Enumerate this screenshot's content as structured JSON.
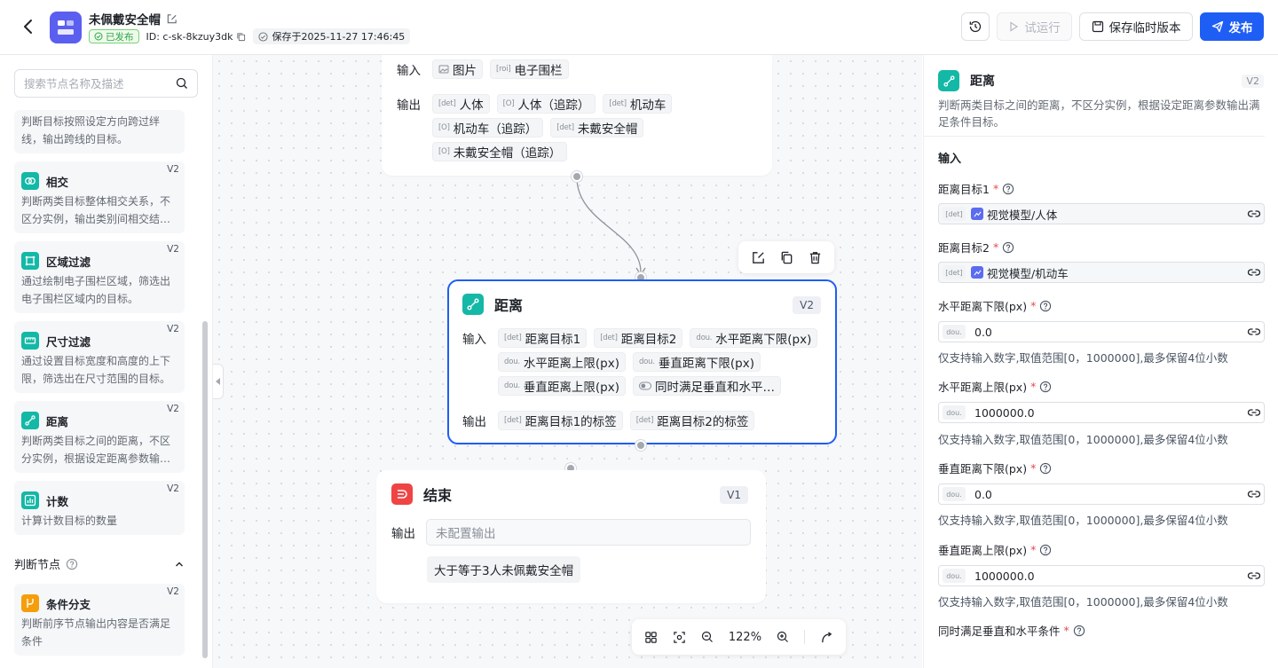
{
  "header": {
    "app_title": "未佩戴安全帽",
    "status": "已发布",
    "id_text": "ID: c-sk-8kzuy3dk",
    "saved_text": "保存于2025-11-27 17:46:45",
    "run_label": "试运行",
    "save_version_label": "保存临时版本",
    "publish_label": "发布"
  },
  "left": {
    "search_placeholder": "搜索节点名称及描述",
    "cards": [
      {
        "desc": "判断目标按照设定方向跨过绊线，输出跨线的目标。"
      },
      {
        "title": "相交",
        "version": "V2",
        "desc": "判断两类目标整体相交关系，不区分实例，输出类别间相交结…"
      },
      {
        "title": "区域过滤",
        "version": "V2",
        "desc": "通过绘制电子围栏区域，筛选出电子围栏区域内的目标。"
      },
      {
        "title": "尺寸过滤",
        "version": "V2",
        "desc": "通过设置目标宽度和高度的上下限，筛选出在尺寸范围的目标。"
      },
      {
        "title": "距离",
        "version": "V2",
        "desc": "判断两类目标之间的距离，不区分实例，根据设定距离参数输…"
      },
      {
        "title": "计数",
        "version": "V2",
        "desc": "计算计数目标的数量"
      },
      {
        "title": "条件分支",
        "version": "V2",
        "desc": "判断前序节点输出内容是否满足条件"
      }
    ],
    "section_title": "判断节点"
  },
  "canvas": {
    "top_node": {
      "input_label": "输入",
      "inputs": [
        {
          "tag": "",
          "text": "图片"
        },
        {
          "tag": "[roi]",
          "text": "电子围栏"
        }
      ],
      "output_label": "输出",
      "outputs_row1": [
        {
          "tag": "[det]",
          "text": "人体"
        },
        {
          "tag": "[O]",
          "text": "人体（追踪）"
        },
        {
          "tag": "[det]",
          "text": "机动车"
        }
      ],
      "outputs_row2": [
        {
          "tag": "[O]",
          "text": "机动车（追踪）"
        },
        {
          "tag": "[det]",
          "text": "未戴安全帽"
        }
      ],
      "outputs_row3": [
        {
          "tag": "[O]",
          "text": "未戴安全帽（追踪）"
        }
      ]
    },
    "distance_node": {
      "title": "距离",
      "version": "V2",
      "input_label": "输入",
      "inputs_row1": [
        {
          "tag": "[det]",
          "text": "距离目标1"
        },
        {
          "tag": "[det]",
          "text": "距离目标2"
        },
        {
          "tag": "dou.",
          "text": "水平距离下限(px)"
        }
      ],
      "inputs_row2": [
        {
          "tag": "dou.",
          "text": "水平距离上限(px)"
        },
        {
          "tag": "dou.",
          "text": "垂直距离下限(px)"
        }
      ],
      "inputs_row3": [
        {
          "tag": "dou.",
          "text": "垂直距离上限(px)"
        },
        {
          "tag": "",
          "text": "同时满足垂直和水平…"
        }
      ],
      "output_label": "输出",
      "outputs": [
        {
          "tag": "[det]",
          "text": "距离目标1的标签"
        },
        {
          "tag": "[det]",
          "text": "距离目标2的标签"
        }
      ]
    },
    "end_node": {
      "title": "结束",
      "version": "V1",
      "output_label": "输出",
      "output_placeholder": "未配置输出",
      "tag_text": "大于等于3人未佩戴安全帽"
    },
    "zoom": "122%"
  },
  "right": {
    "title": "距离",
    "version": "V2",
    "desc": "判断两类目标之间的距离，不区分实例，根据设定距离参数输出满足条件目标。",
    "input_section": "输入",
    "fields": [
      {
        "label": "距离目标1",
        "tag": "[det]",
        "value": "视觉模型/人体"
      },
      {
        "label": "距离目标2",
        "tag": "[det]",
        "value": "视觉模型/机动车"
      },
      {
        "label": "水平距离下限(px)",
        "tag": "dou.",
        "value": "0.0",
        "hint": "仅支持输入数字,取值范围[0，1000000],最多保留4位小数"
      },
      {
        "label": "水平距离上限(px)",
        "tag": "dou.",
        "value": "1000000.0",
        "hint": "仅支持输入数字,取值范围[0，1000000],最多保留4位小数"
      },
      {
        "label": "垂直距离下限(px)",
        "tag": "dou.",
        "value": "0.0",
        "hint": "仅支持输入数字,取值范围[0，1000000],最多保留4位小数"
      },
      {
        "label": "垂直距离上限(px)",
        "tag": "dou.",
        "value": "1000000.0",
        "hint": "仅支持输入数字,取值范围[0，1000000],最多保留4位小数"
      },
      {
        "label": "同时满足垂直和水平条件"
      }
    ]
  },
  "colors": {
    "primary": "#1f5ef5",
    "teal": "#14b8a6",
    "orange": "#f59e0b",
    "red_end": "#ef4444",
    "published_green": "#2ea54a"
  }
}
